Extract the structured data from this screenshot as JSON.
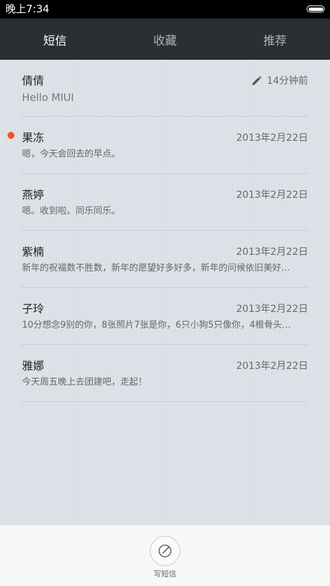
{
  "status_bar": {
    "time": "晚上7:34"
  },
  "tabs": [
    {
      "label": "短信",
      "active": true
    },
    {
      "label": "收藏",
      "active": false
    },
    {
      "label": "推荐",
      "active": false
    }
  ],
  "conversations": [
    {
      "name": "倩倩",
      "time": "14分钟前",
      "preview": "Hello MIUI",
      "draft": true,
      "unread": false
    },
    {
      "name": "果冻",
      "time": "2013年2月22日",
      "preview": "嗯，今天会回去的早点。",
      "draft": false,
      "unread": false
    },
    {
      "name": "燕婷",
      "time": "2013年2月22日",
      "preview": "嗯。收到啦。同乐同乐。",
      "draft": false,
      "unread": true
    },
    {
      "name": "紫楠",
      "time": "2013年2月22日",
      "preview": "新年的祝福数不胜数，新年的愿望好多好多，新年的问候依旧美好…",
      "draft": false,
      "unread": false
    },
    {
      "name": "子玲",
      "time": "2013年2月22日",
      "preview": "10分想念9别的你，8张照片7张是你，6只小狗5只像你，4根骨头…",
      "draft": false,
      "unread": false
    },
    {
      "name": "雅娜",
      "time": "2013年2月22日",
      "preview": "今天周五晚上去团建吧，走起！",
      "draft": false,
      "unread": false
    }
  ],
  "bottom_bar": {
    "compose_label": "写短信",
    "compose_icon": "compose-icon"
  },
  "colors": {
    "unread_dot": "#f4511e",
    "tab_bar": "#2b2f33",
    "list_bg": "#dcdfe6"
  }
}
